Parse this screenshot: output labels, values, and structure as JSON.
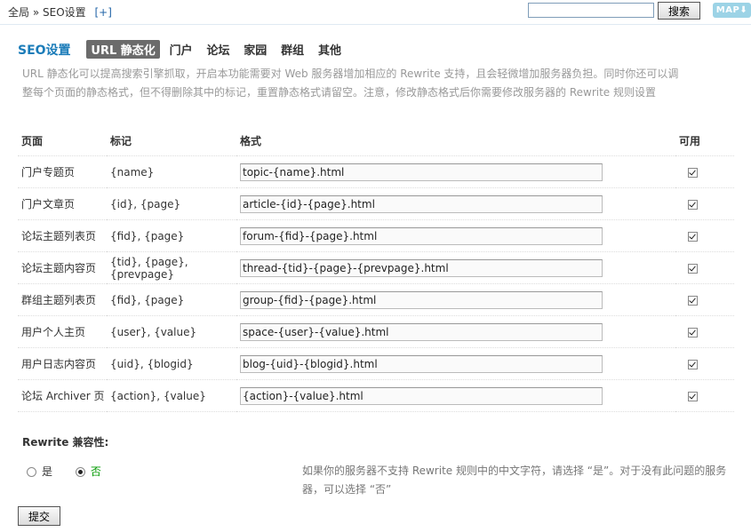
{
  "topbar": {
    "breadcrumb_root": "全局",
    "breadcrumb_sep": "»",
    "breadcrumb_current": "SEO设置",
    "add_label": "[+]",
    "search_value": "",
    "search_button": "搜索",
    "map_label": "MAP"
  },
  "tabs": {
    "title": "SEO设置",
    "items": [
      "URL 静态化",
      "门户",
      "论坛",
      "家园",
      "群组",
      "其他"
    ],
    "active_index": 0
  },
  "description": "URL 静态化可以提高搜索引擎抓取，开启本功能需要对 Web 服务器增加相应的 Rewrite 支持，且会轻微增加服务器负担。同时你还可以调整每个页面的静态格式，但不得删除其中的标记，重置静态格式请留空。注意，修改静态格式后你需要修改服务器的 Rewrite 规则设置",
  "table": {
    "headers": [
      "页面",
      "标记",
      "格式",
      "可用"
    ],
    "rows": [
      {
        "page": "门户专题页",
        "tags": "{name}",
        "format": "topic-{name}.html",
        "enabled": true
      },
      {
        "page": "门户文章页",
        "tags": "{id}, {page}",
        "format": "article-{id}-{page}.html",
        "enabled": true
      },
      {
        "page": "论坛主题列表页",
        "tags": "{fid}, {page}",
        "format": "forum-{fid}-{page}.html",
        "enabled": true
      },
      {
        "page": "论坛主题内容页",
        "tags": "{tid}, {page}, {prevpage}",
        "format": "thread-{tid}-{page}-{prevpage}.html",
        "enabled": true
      },
      {
        "page": "群组主题列表页",
        "tags": "{fid}, {page}",
        "format": "group-{fid}-{page}.html",
        "enabled": true
      },
      {
        "page": "用户个人主页",
        "tags": "{user}, {value}",
        "format": "space-{user}-{value}.html",
        "enabled": true
      },
      {
        "page": "用户日志内容页",
        "tags": "{uid}, {blogid}",
        "format": "blog-{uid}-{blogid}.html",
        "enabled": true
      },
      {
        "page": "论坛 Archiver 页",
        "tags": "{action}, {value}",
        "format": "{action}-{value}.html",
        "enabled": true
      }
    ]
  },
  "rewrite": {
    "label": "Rewrite 兼容性:",
    "yes": "是",
    "no": "否",
    "selected": "no",
    "hint": "如果你的服务器不支持 Rewrite 规则中的中文字符，请选择 “是”。对于没有此问题的服务器，可以选择 “否”"
  },
  "submit_label": "提交"
}
